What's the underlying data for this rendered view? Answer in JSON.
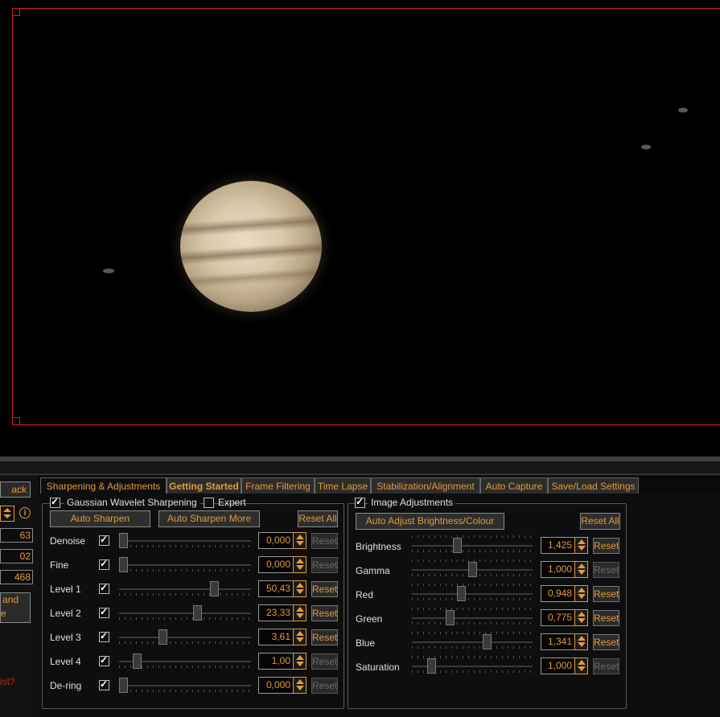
{
  "left_panel": {
    "back_label": "ack",
    "value_1": "63",
    "value_2": "02",
    "value_3": "468",
    "band_label": "and",
    "band_label_2": "e",
    "help_text": "ist?"
  },
  "tabs": [
    {
      "label": "Sharpening & Adjustments"
    },
    {
      "label": "Getting Started"
    },
    {
      "label": "Frame Filtering"
    },
    {
      "label": "Time Lapse"
    },
    {
      "label": "Stabilization/Alignment"
    },
    {
      "label": "Auto Capture"
    },
    {
      "label": "Save/Load Settings"
    }
  ],
  "sharpening": {
    "group_label": "Gaussian Wavelet Sharpening",
    "expert_label": "Expert",
    "auto_sharpen": "Auto Sharpen",
    "auto_sharpen_more": "Auto Sharpen More",
    "reset_all": "Reset All",
    "reset_label": "Reset",
    "rows": [
      {
        "label": "Denoise",
        "value": "0,000",
        "level": 0.0
      },
      {
        "label": "Fine",
        "value": "0,000",
        "level": 0.0
      },
      {
        "label": "Level 1",
        "value": "50,43",
        "level": 0.74
      },
      {
        "label": "Level 2",
        "value": "23,33",
        "level": 0.6
      },
      {
        "label": "Level 3",
        "value": "3,61",
        "level": 0.32
      },
      {
        "label": "Level 4",
        "value": "1,00",
        "level": 0.11
      },
      {
        "label": "De-ring",
        "value": "0,000",
        "level": 0.0
      }
    ]
  },
  "adjustments": {
    "group_label": "Image Adjustments",
    "auto_adjust": "Auto Adjust Brightness/Colour",
    "reset_all": "Reset All",
    "reset_label": "Reset",
    "rows": [
      {
        "label": "Brightness",
        "value": "1,425",
        "level": 0.37
      },
      {
        "label": "Gamma",
        "value": "1,000",
        "level": 0.5
      },
      {
        "label": "Red",
        "value": "0,948",
        "level": 0.4
      },
      {
        "label": "Green",
        "value": "0,775",
        "level": 0.3
      },
      {
        "label": "Blue",
        "value": "1,341",
        "level": 0.63
      },
      {
        "label": "Saturation",
        "value": "1,000",
        "level": 0.14
      }
    ]
  }
}
